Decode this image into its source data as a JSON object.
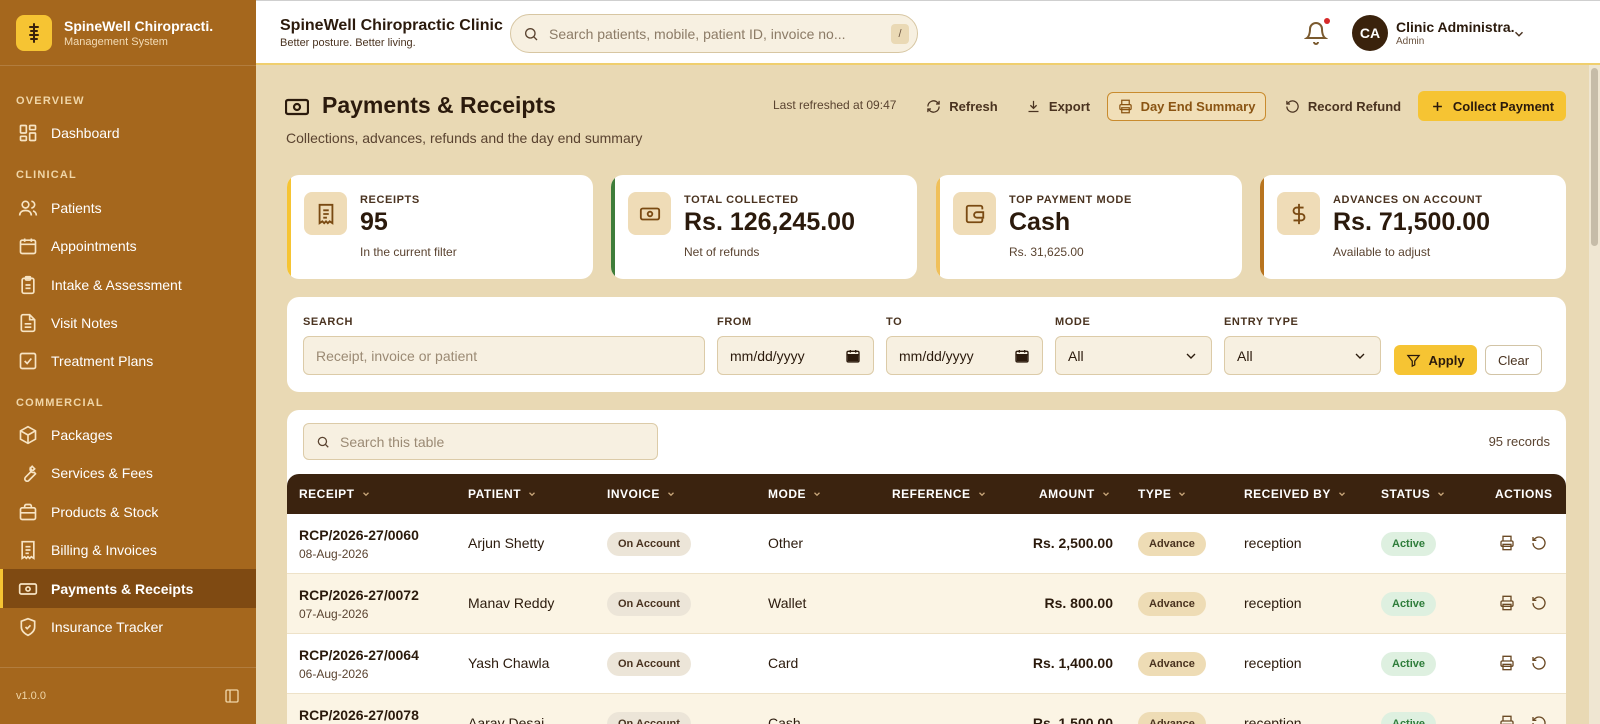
{
  "sidebar": {
    "brand_title": "SpineWell Chiropracti.",
    "brand_subtitle": "Management System",
    "sections": {
      "overview": "OVERVIEW",
      "clinical": "CLINICAL",
      "commercial": "COMMERCIAL"
    },
    "items": [
      {
        "label": "Dashboard",
        "icon": "dashboard-icon"
      },
      {
        "label": "Patients",
        "icon": "users-icon"
      },
      {
        "label": "Appointments",
        "icon": "calendar-icon"
      },
      {
        "label": "Intake & Assessment",
        "icon": "clipboard-icon"
      },
      {
        "label": "Visit Notes",
        "icon": "file-icon"
      },
      {
        "label": "Treatment Plans",
        "icon": "check-square-icon"
      },
      {
        "label": "Packages",
        "icon": "package-icon"
      },
      {
        "label": "Services & Fees",
        "icon": "wrench-icon"
      },
      {
        "label": "Products & Stock",
        "icon": "briefcase-icon"
      },
      {
        "label": "Billing & Invoices",
        "icon": "receipt-icon"
      },
      {
        "label": "Payments & Receipts",
        "icon": "banknote-icon",
        "active": true
      },
      {
        "label": "Insurance Tracker",
        "icon": "shield-icon"
      }
    ],
    "version": "v1.0.0"
  },
  "header": {
    "clinic_name": "SpineWell Chiropractic Clinic",
    "tagline": "Better posture. Better living.",
    "search_placeholder": "Search patients, mobile, patient ID, invoice no...",
    "search_shortcut": "/",
    "user_initials": "CA",
    "user_name": "Clinic Administra.",
    "user_role": "Admin"
  },
  "page": {
    "title": "Payments & Receipts",
    "subtitle": "Collections, advances, refunds and the day end summary",
    "last_refreshed": "Last refreshed at 09:47",
    "buttons": {
      "refresh": "Refresh",
      "export": "Export",
      "day_end": "Day End Summary",
      "record_refund": "Record Refund",
      "collect_payment": "Collect Payment"
    }
  },
  "stats": [
    {
      "label": "RECEIPTS",
      "value": "95",
      "note": "In the current filter",
      "accent": "#f6c433",
      "icon": "receipt-icon"
    },
    {
      "label": "TOTAL COLLECTED",
      "value": "Rs. 126,245.00",
      "note": "Net of refunds",
      "accent": "#3f7d3a",
      "icon": "banknote-icon"
    },
    {
      "label": "TOP PAYMENT MODE",
      "value": "Cash",
      "note": "Rs. 31,625.00",
      "accent": "#f0c05a",
      "icon": "wallet-icon"
    },
    {
      "label": "ADVANCES ON ACCOUNT",
      "value": "Rs. 71,500.00",
      "note": "Available to adjust",
      "accent": "#b8741f",
      "icon": "dollar-icon"
    }
  ],
  "filters": {
    "search_label": "SEARCH",
    "search_placeholder": "Receipt, invoice or patient",
    "from_label": "FROM",
    "from_value": "mm/dd/yyyy",
    "to_label": "TO",
    "to_value": "mm/dd/yyyy",
    "mode_label": "MODE",
    "mode_value": "All",
    "entry_type_label": "ENTRY TYPE",
    "entry_type_value": "All",
    "apply": "Apply",
    "clear": "Clear"
  },
  "table": {
    "search_placeholder": "Search this table",
    "record_count": "95 records",
    "columns": [
      "RECEIPT",
      "PATIENT",
      "INVOICE",
      "MODE",
      "REFERENCE",
      "AMOUNT",
      "TYPE",
      "RECEIVED BY",
      "STATUS",
      "ACTIONS"
    ],
    "rows": [
      {
        "receipt": "RCP/2026-27/0060",
        "date": "08-Aug-2026",
        "patient": "Arjun Shetty",
        "invoice": "On Account",
        "mode": "Other",
        "reference": "",
        "amount": "Rs. 2,500.00",
        "type": "Advance",
        "received_by": "reception",
        "status": "Active"
      },
      {
        "receipt": "RCP/2026-27/0072",
        "date": "07-Aug-2026",
        "patient": "Manav Reddy",
        "invoice": "On Account",
        "mode": "Wallet",
        "reference": "",
        "amount": "Rs. 800.00",
        "type": "Advance",
        "received_by": "reception",
        "status": "Active"
      },
      {
        "receipt": "RCP/2026-27/0064",
        "date": "06-Aug-2026",
        "patient": "Yash Chawla",
        "invoice": "On Account",
        "mode": "Card",
        "reference": "",
        "amount": "Rs. 1,400.00",
        "type": "Advance",
        "received_by": "reception",
        "status": "Active"
      },
      {
        "receipt": "RCP/2026-27/0078",
        "date": "",
        "patient": "Aarav Desai",
        "invoice": "On Account",
        "mode": "Cash",
        "reference": "",
        "amount": "Rs. 1,500.00",
        "type": "Advance",
        "received_by": "reception",
        "status": "Active"
      }
    ]
  }
}
